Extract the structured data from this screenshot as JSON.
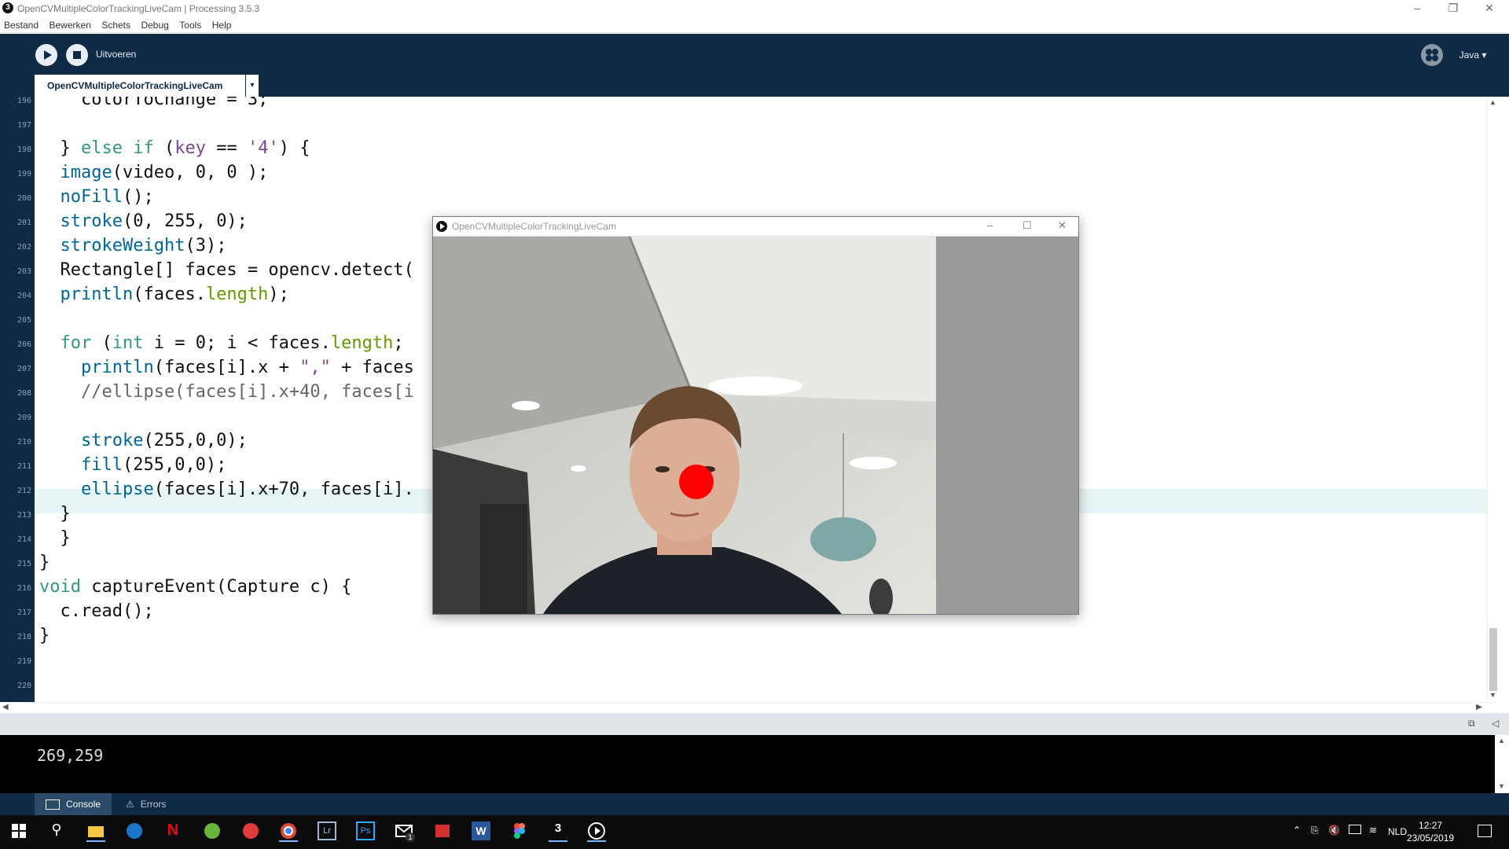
{
  "window": {
    "title": "OpenCVMultipleColorTrackingLiveCam | Processing 3.5.3"
  },
  "menu": [
    "Bestand",
    "Bewerken",
    "Schets",
    "Debug",
    "Tools",
    "Help"
  ],
  "toolbar": {
    "run_label": "Uitvoeren",
    "mode_label": "Java ▾"
  },
  "tab": {
    "label": "OpenCVMultipleColorTrackingLiveCam",
    "arrow": "▾"
  },
  "editor": {
    "current_line": 212,
    "lines": [
      {
        "n": "196",
        "t": "    colorToChange = 3;"
      },
      {
        "n": "197",
        "t": ""
      },
      {
        "n": "198",
        "t": "  } else if (key == '4') {"
      },
      {
        "n": "199",
        "t": "  image(video, 0, 0 );"
      },
      {
        "n": "200",
        "t": "  noFill();"
      },
      {
        "n": "201",
        "t": "  stroke(0, 255, 0);"
      },
      {
        "n": "202",
        "t": "  strokeWeight(3);"
      },
      {
        "n": "203",
        "t": "  Rectangle[] faces = opencv.detect("
      },
      {
        "n": "204",
        "t": "  println(faces.length);"
      },
      {
        "n": "205",
        "t": ""
      },
      {
        "n": "206",
        "t": "  for (int i = 0; i < faces.length;"
      },
      {
        "n": "207",
        "t": "    println(faces[i].x + \",\" + faces"
      },
      {
        "n": "208",
        "t": "    //ellipse(faces[i].x+40, faces[i"
      },
      {
        "n": "209",
        "t": ""
      },
      {
        "n": "210",
        "t": "    stroke(255,0,0);"
      },
      {
        "n": "211",
        "t": "    fill(255,0,0);"
      },
      {
        "n": "212",
        "t": "    ellipse(faces[i].x+70, faces[i]."
      },
      {
        "n": "213",
        "t": "  }"
      },
      {
        "n": "214",
        "t": "  }"
      },
      {
        "n": "215",
        "t": "}"
      },
      {
        "n": "216",
        "t": "void captureEvent(Capture c) {"
      },
      {
        "n": "217",
        "t": "  c.read();"
      },
      {
        "n": "218",
        "t": "}"
      },
      {
        "n": "219",
        "t": ""
      },
      {
        "n": "220",
        "t": ""
      }
    ]
  },
  "console": {
    "output": "269,259",
    "tabs": [
      "Console",
      "Errors"
    ]
  },
  "sketch_window": {
    "title": "OpenCVMultipleColorTrackingLiveCam"
  },
  "taskbar": {
    "language": "NLD",
    "time": "12:27",
    "date": "23/05/2019",
    "mail_badge": "1"
  },
  "colors": {
    "toolbar": "#0f2a44",
    "accent_red": "#ff0000",
    "current_line": "#e8f5f7"
  }
}
